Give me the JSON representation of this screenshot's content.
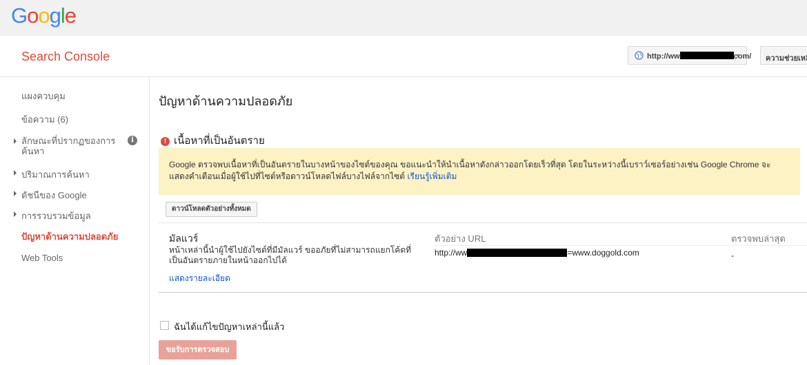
{
  "topbar": {
    "logo_letters": [
      {
        "ch": "G",
        "color": "#4285f4"
      },
      {
        "ch": "o",
        "color": "#ea4335"
      },
      {
        "ch": "o",
        "color": "#fbbc05"
      },
      {
        "ch": "g",
        "color": "#4285f4"
      },
      {
        "ch": "l",
        "color": "#34a853"
      },
      {
        "ch": "e",
        "color": "#ea4335"
      }
    ]
  },
  "header": {
    "brand": "Search Console",
    "site_prefix": "http://ww",
    "site_suffix": "com/",
    "help_label": "ความช่วยเหลือ"
  },
  "sidebar": {
    "items": [
      {
        "label": "แผงควบคุม"
      },
      {
        "label": "ข้อความ (6)"
      },
      {
        "label_line1": "ลักษณะที่ปรากฏของการ",
        "label_line2": "ค้นหา"
      },
      {
        "label": "ปริมาณการค้นหา"
      },
      {
        "label": "ดัชนีของ Google"
      },
      {
        "label": "การรวบรวมข้อมูล"
      },
      {
        "label": "ปัญหาด้านความปลอดภัย"
      },
      {
        "label": "Web Tools"
      }
    ]
  },
  "main": {
    "title": "ปัญหาด้านความปลอดภัย",
    "section_title": "เนื้อหาที่เป็นอันตราย",
    "notice_line1": "Google ตรวจพบเนื้อหาที่เป็นอันตรายในบางหน้าของไซต์ของคุณ ขอแนะนำให้นำเนื้อหาดังกล่าวออกโดยเร็วที่สุด โดยในระหว่างนี้เบราว์เซอร์อย่างเช่น Google Chrome จะ",
    "notice_line2": "แสดงคำเตือนเมื่อผู้ใช้ไปที่ไซต์หรือดาวน์โหลดไฟล์บางไฟล์จากไซต์",
    "learn_more": "เรียนรู้เพิ่มเติม",
    "download_button": "ดาวน์โหลดตัวอย่างทั้งหมด",
    "malware": {
      "title": "มัลแวร์",
      "description": "หน้าเหล่านี้นำผู้ใช้ไปยังไซต์ที่มีมัลแวร์ ขออภัยที่ไม่สามารถแยกโค้ดที่เป็นอันตรายภายในหน้าออกไปได้",
      "details_link": "แสดงรายละเอียด",
      "col_url": "ตัวอย่าง URL",
      "col_detected": "ตรวจพบล่าสุด",
      "url_prefix": "http://ww",
      "url_suffix": "=www.doggold.com",
      "detected": "-"
    },
    "fixed_checkbox_label": "ฉันได้แก้ไขปัญหาเหล่านี้แล้ว",
    "review_button": "ขอรับการตรวจสอบ"
  }
}
